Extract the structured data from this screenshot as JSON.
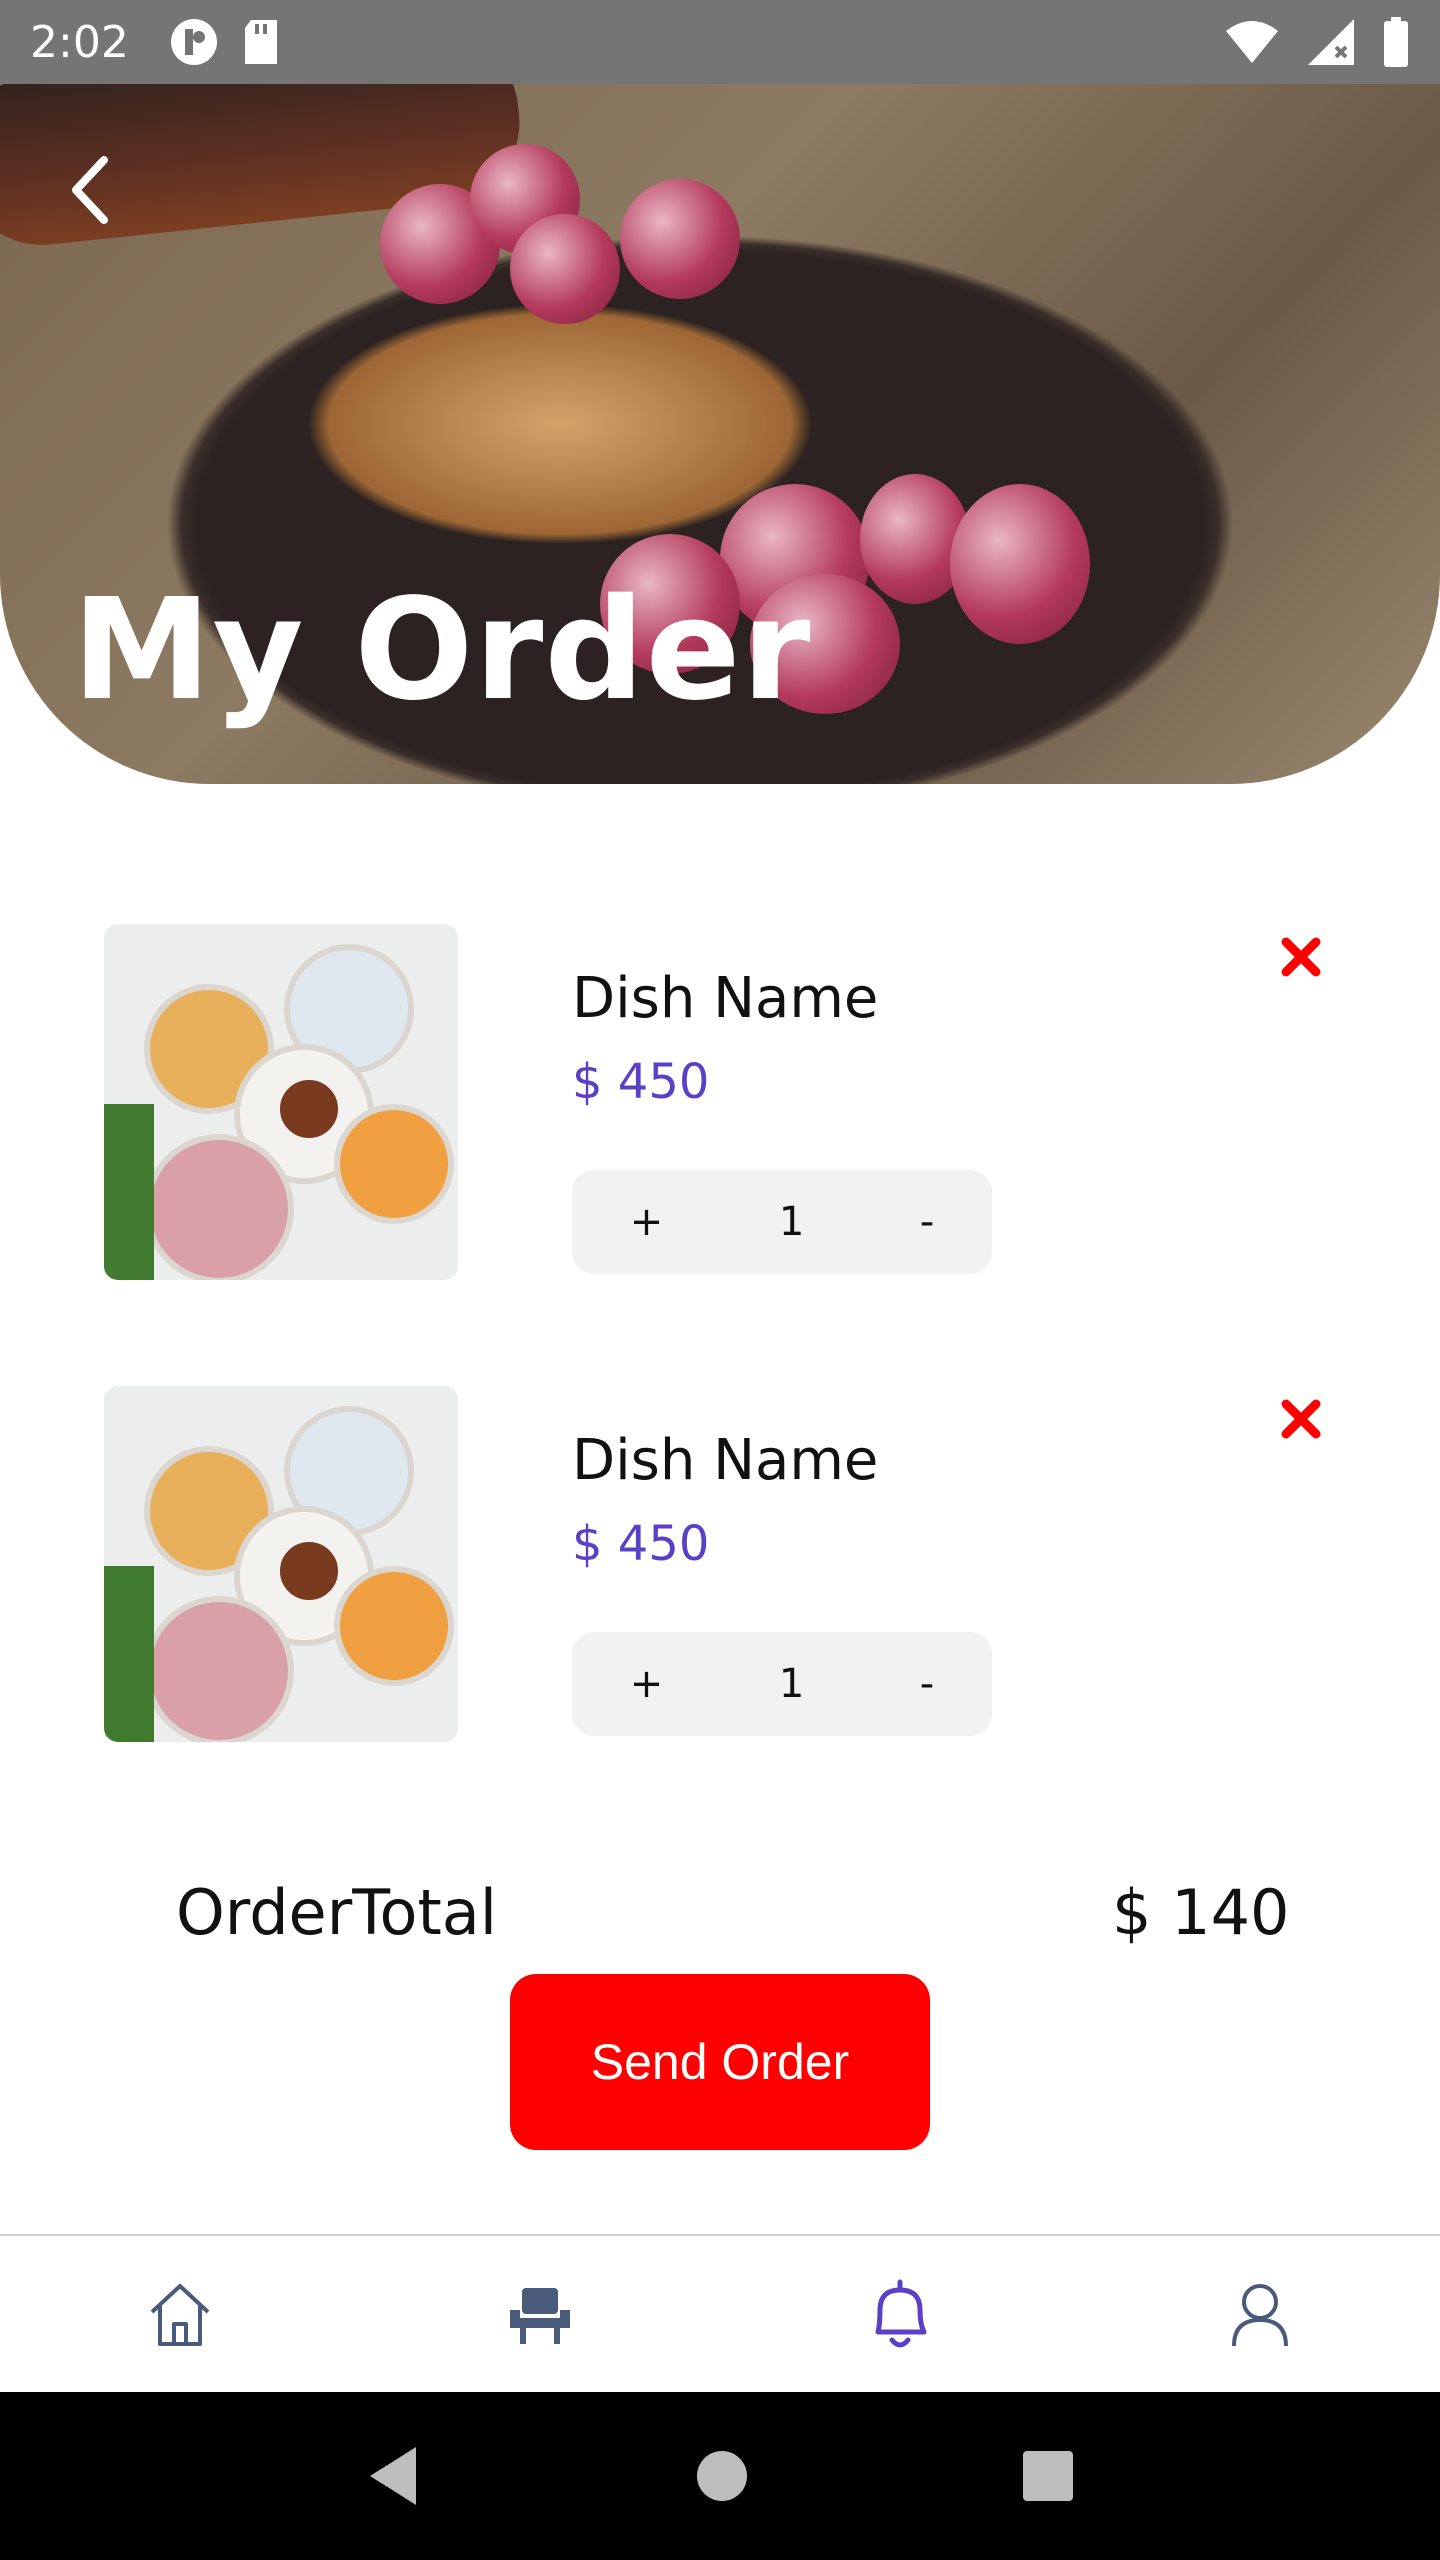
{
  "status_bar": {
    "time": "2:02"
  },
  "header": {
    "title": "My Order"
  },
  "order": {
    "items": [
      {
        "name": "Dish Name",
        "price": "$ 450",
        "quantity": "1",
        "plus": "+",
        "minus": "-"
      },
      {
        "name": "Dish Name",
        "price": "$ 450",
        "quantity": "1",
        "plus": "+",
        "minus": "-"
      }
    ],
    "total_label": "OrderTotal",
    "total_value": "$ 140",
    "send_label": "Send Order"
  },
  "nav": {
    "items": [
      {
        "icon": "home-icon",
        "active": false
      },
      {
        "icon": "chair-icon",
        "active": false
      },
      {
        "icon": "bell-icon",
        "active": true
      },
      {
        "icon": "profile-icon",
        "active": false
      }
    ]
  },
  "colors": {
    "accent": "#5a3fc7",
    "send_button": "#ff0000",
    "remove_icon": "#ff0000",
    "status_bar": "#757575"
  }
}
